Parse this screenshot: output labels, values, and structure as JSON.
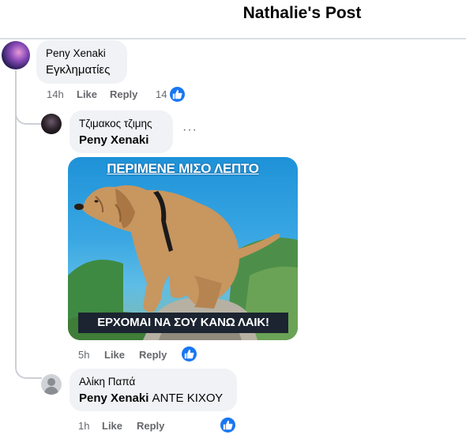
{
  "header": {
    "title": "Nathalie's Post"
  },
  "comments": [
    {
      "author": "Peny Xenaki",
      "text": "Εγκληματίες",
      "time": "14h",
      "like_label": "Like",
      "reply_label": "Reply",
      "reaction_count": "14"
    }
  ],
  "replies": [
    {
      "author": "Τζιμακος τζιμης",
      "mention": "Peny Xenaki",
      "text": "",
      "time": "5h",
      "like_label": "Like",
      "reply_label": "Reply",
      "more_label": "···",
      "meme": {
        "top_caption": "ΠΕΡΙΜΕΝΕ ΜΙΣΟ ΛΕΠΤΟ",
        "bottom_caption": "ΕΡΧΟΜΑΙ ΝΑ ΣΟΥ ΚΑΝΩ ΛΑΙΚ!"
      }
    },
    {
      "author": "Αλίκη Παπά",
      "mention": "Peny Xenaki",
      "text": " ΑΝΤΕ ΚΙΧΟΥ",
      "time": "1h",
      "like_label": "Like",
      "reply_label": "Reply"
    }
  ],
  "colors": {
    "accent": "#1877f2",
    "bubble": "#f0f2f5",
    "meta": "#65676b"
  },
  "icons": {
    "reaction": "thumbs-up-icon"
  }
}
